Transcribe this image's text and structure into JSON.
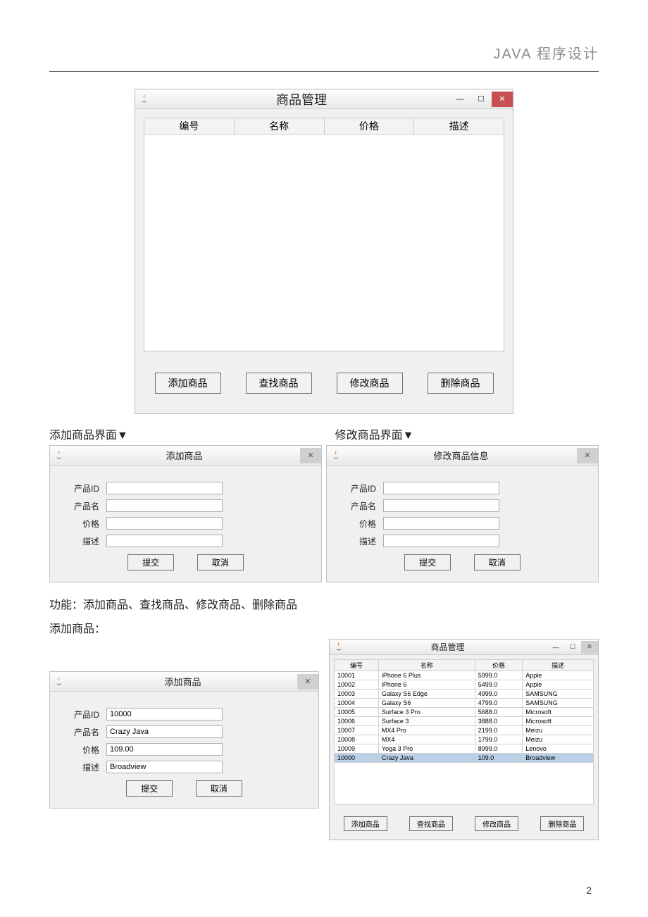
{
  "doc": {
    "header": "JAVA 程序设计",
    "page_number": "2",
    "caption_add": "添加商品界面▼",
    "caption_modify": "修改商品界面▼",
    "func_line": "功能：添加商品、查找商品、修改商品、删除商品",
    "add_line": "添加商品："
  },
  "main_window": {
    "title": "商品管理",
    "columns": [
      "编号",
      "名称",
      "价格",
      "描述"
    ],
    "buttons": {
      "add": "添加商品",
      "find": "查找商品",
      "modify": "修改商品",
      "delete": "删除商品"
    }
  },
  "add_dialog": {
    "title": "添加商品",
    "labels": {
      "id": "产品ID",
      "name": "产品名",
      "price": "价格",
      "desc": "描述"
    },
    "buttons": {
      "submit": "提交",
      "cancel": "取消"
    }
  },
  "modify_dialog": {
    "title": "修改商品信息",
    "labels": {
      "id": "产品ID",
      "name": "产品名",
      "price": "价格",
      "desc": "描述"
    },
    "buttons": {
      "submit": "提交",
      "cancel": "取消"
    }
  },
  "filled_add_dialog": {
    "title": "添加商品",
    "values": {
      "id": "10000",
      "name": "Crazy Java",
      "price": "109.00",
      "desc": "Broadview"
    }
  },
  "mini_main": {
    "title": "商品管理",
    "columns": [
      "编号",
      "名称",
      "价格",
      "描述"
    ],
    "rows": [
      {
        "id": "10001",
        "name": "iPhone 6 Plus",
        "price": "5999.0",
        "desc": "Apple"
      },
      {
        "id": "10002",
        "name": "iPhone 6",
        "price": "5499.0",
        "desc": "Apple"
      },
      {
        "id": "10003",
        "name": "Galaxy S6 Edge",
        "price": "4999.0",
        "desc": "SAMSUNG"
      },
      {
        "id": "10004",
        "name": "Galaxy S6",
        "price": "4799.0",
        "desc": "SAMSUNG"
      },
      {
        "id": "10005",
        "name": "Surface 3 Pro",
        "price": "5688.0",
        "desc": "Microsoft"
      },
      {
        "id": "10006",
        "name": "Surface 3",
        "price": "3888.0",
        "desc": "Microsoft"
      },
      {
        "id": "10007",
        "name": "MX4 Pro",
        "price": "2199.0",
        "desc": "Meizu"
      },
      {
        "id": "10008",
        "name": "MX4",
        "price": "1799.0",
        "desc": "Meizu"
      },
      {
        "id": "10009",
        "name": "Yoga 3 Pro",
        "price": "8999.0",
        "desc": "Lenovo"
      },
      {
        "id": "10000",
        "name": "Crazy Java",
        "price": "109.0",
        "desc": "Broadview",
        "selected": true
      }
    ],
    "buttons": {
      "add": "添加商品",
      "find": "查找商品",
      "modify": "修改商品",
      "delete": "删除商品"
    }
  }
}
